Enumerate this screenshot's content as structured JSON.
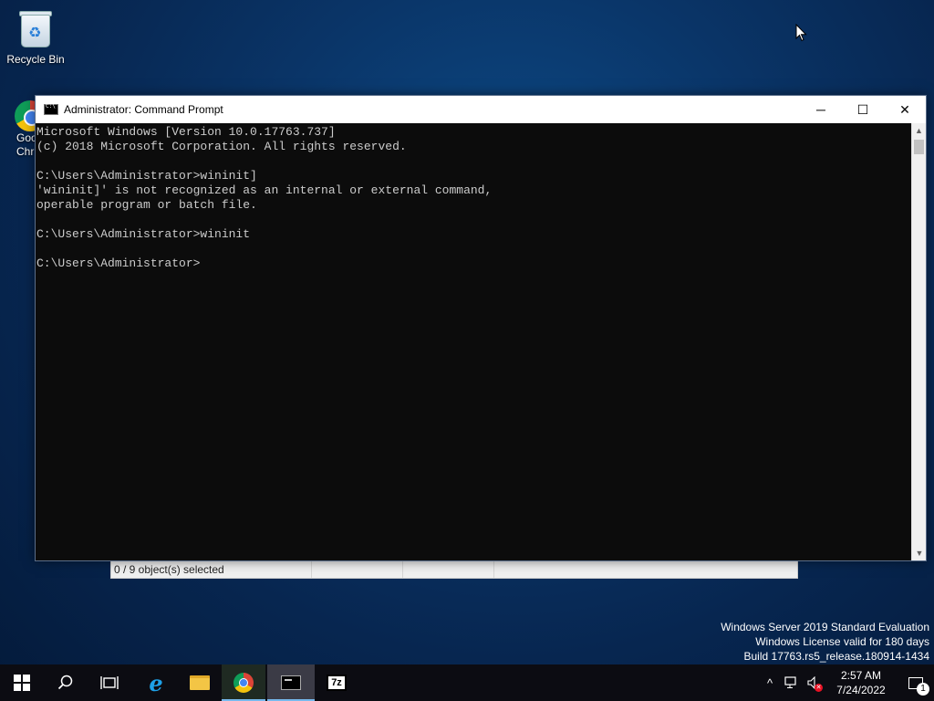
{
  "desktop": {
    "recycle_bin_label": "Recycle Bin",
    "chrome_label_line1": "Goo",
    "chrome_label_line2": "Chr"
  },
  "explorer_status": {
    "selected": "0 / 9 object(s) selected"
  },
  "cmd": {
    "title": "Administrator: Command Prompt",
    "lines": [
      "Microsoft Windows [Version 10.0.17763.737]",
      "(c) 2018 Microsoft Corporation. All rights reserved.",
      "",
      "C:\\Users\\Administrator>wininit]",
      "'wininit]' is not recognized as an internal or external command,",
      "operable program or batch file.",
      "",
      "C:\\Users\\Administrator>wininit",
      "",
      "C:\\Users\\Administrator>"
    ],
    "buttons": {
      "minimize": "─",
      "maximize": "☐",
      "close": "✕"
    },
    "background": "#0c0c0c",
    "text_color": "#cccccc"
  },
  "watermark": {
    "line1": "Windows Server 2019 Standard Evaluation",
    "line2": "Windows License valid for 180 days",
    "line3": "Build 17763.rs5_release.180914-1434"
  },
  "taskbar": {
    "apps": [
      {
        "name": "start",
        "icon": "windows-logo-icon"
      },
      {
        "name": "search",
        "icon": "search-icon"
      },
      {
        "name": "task-view",
        "icon": "task-view-icon"
      },
      {
        "name": "internet-explorer",
        "icon": "ie-icon"
      },
      {
        "name": "file-explorer",
        "icon": "folder-icon"
      },
      {
        "name": "chrome",
        "icon": "chrome-icon"
      },
      {
        "name": "command-prompt",
        "icon": "cmd-icon"
      },
      {
        "name": "7zip",
        "icon": "7zip-icon",
        "label": "7z"
      }
    ],
    "tray": {
      "chevron": "^",
      "time": "2:57 AM",
      "date": "7/24/2022",
      "notifications_count": "1"
    },
    "accent": "#76b9ed"
  }
}
